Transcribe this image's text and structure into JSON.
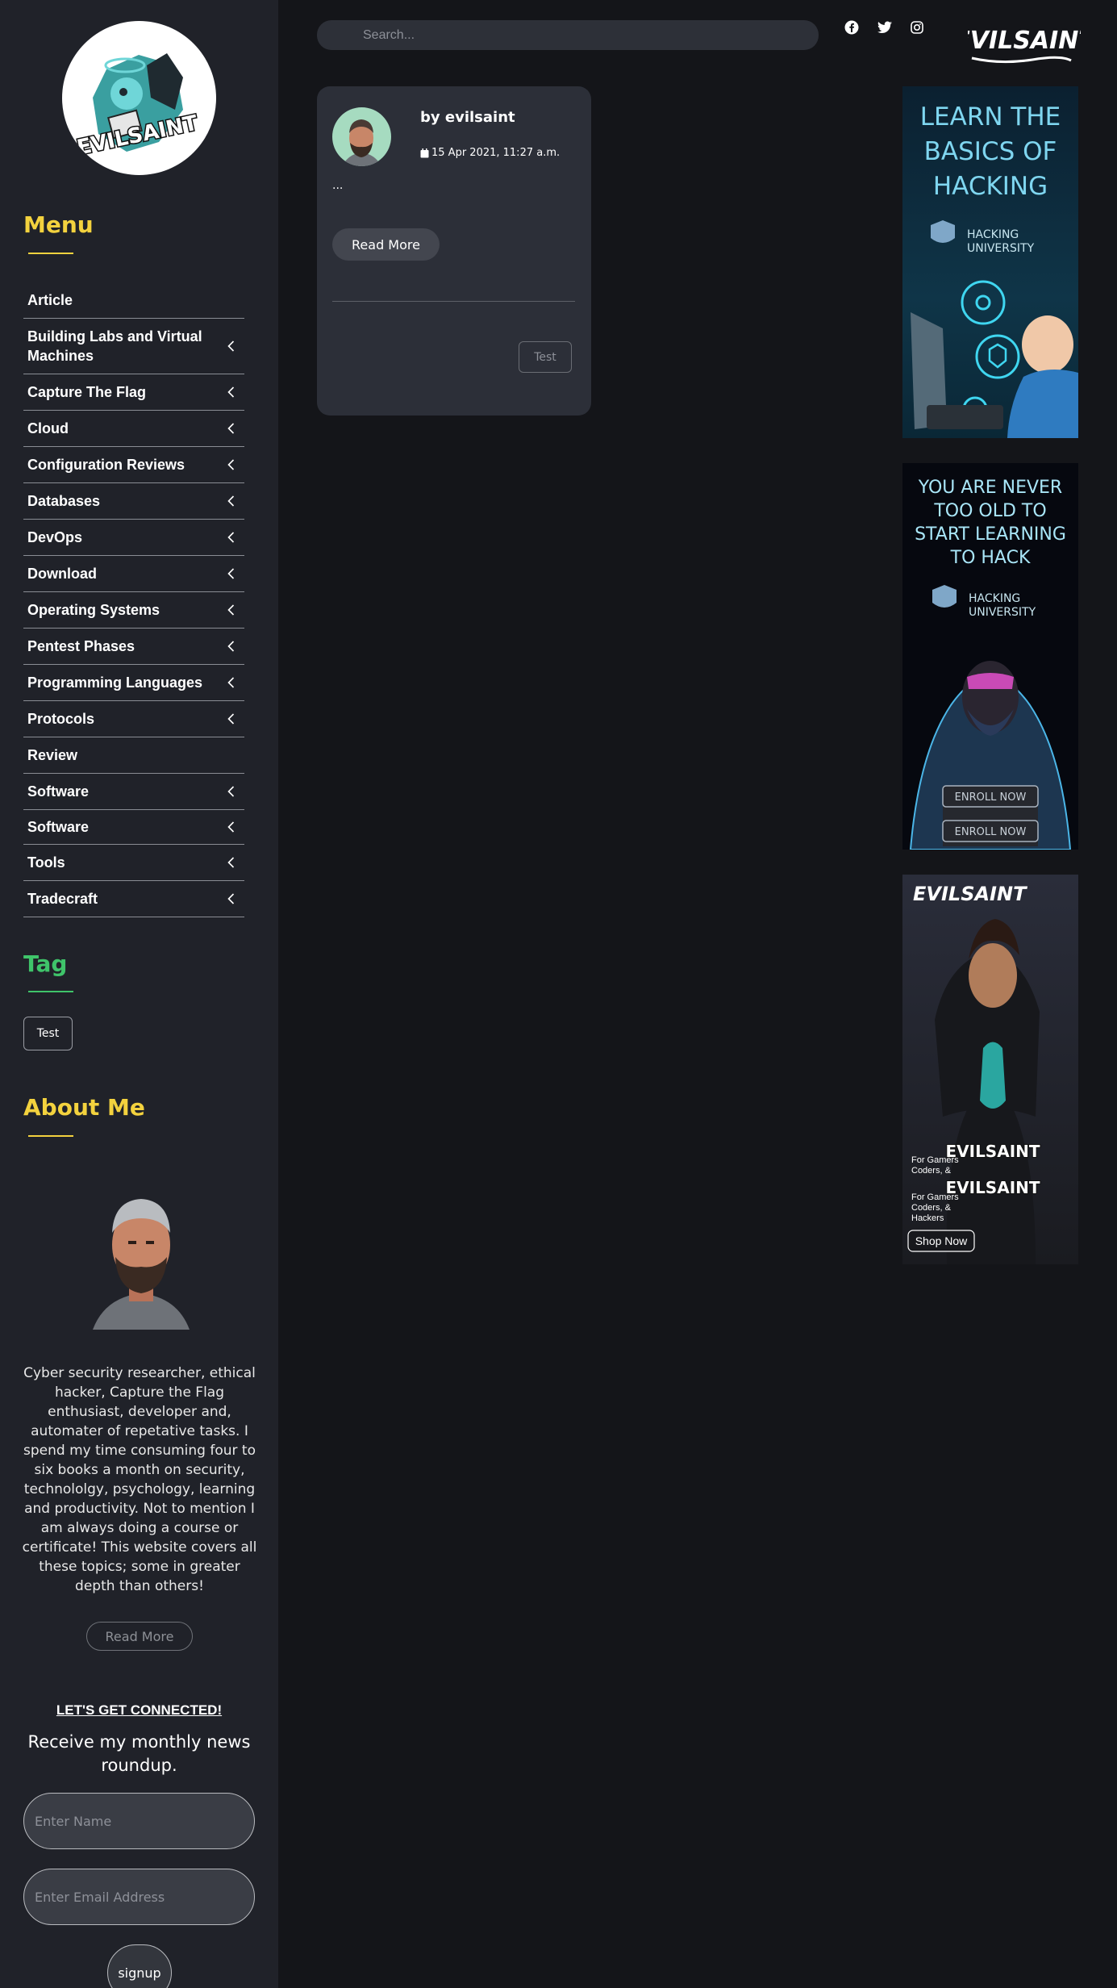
{
  "sidebar": {
    "logo_text": "EVILSAINT",
    "menu_title": "Menu",
    "menu_items": [
      {
        "label": "Article",
        "has_chevron": false
      },
      {
        "label": "Building Labs and Virtual Machines",
        "has_chevron": true
      },
      {
        "label": "Capture The Flag",
        "has_chevron": true
      },
      {
        "label": "Cloud",
        "has_chevron": true
      },
      {
        "label": "Configuration Reviews",
        "has_chevron": true
      },
      {
        "label": "Databases",
        "has_chevron": true
      },
      {
        "label": "DevOps",
        "has_chevron": true
      },
      {
        "label": "Download",
        "has_chevron": true
      },
      {
        "label": "Operating Systems",
        "has_chevron": true
      },
      {
        "label": "Pentest Phases",
        "has_chevron": true
      },
      {
        "label": "Programming Languages",
        "has_chevron": true
      },
      {
        "label": "Protocols",
        "has_chevron": true
      },
      {
        "label": "Review",
        "has_chevron": false
      },
      {
        "label": "Software",
        "has_chevron": true
      },
      {
        "label": "Software",
        "has_chevron": true
      },
      {
        "label": "Tools",
        "has_chevron": true
      },
      {
        "label": "Tradecraft",
        "has_chevron": true
      }
    ],
    "tag_title": "Tag",
    "tags": [
      "Test"
    ],
    "about_title": "About Me",
    "about_text": "Cyber security researcher, ethical hacker, Capture the Flag enthusiast, developer and, automater of repetative tasks. I spend my time consuming four to six books a month on security, technololgy, psychology, learning and productivity. Not to mention I am always doing a course or certificate! This website covers all these topics; some in greater depth than others!",
    "about_button": "Read More",
    "connect_heading": "LET'S GET CONNECTED!",
    "connect_sub": "Receive my monthly news roundup.",
    "name_placeholder": "Enter Name",
    "email_placeholder": "Enter Email Address",
    "signup_label": "signup"
  },
  "header": {
    "search_placeholder": "Search...",
    "social_icons": [
      "facebook-icon",
      "twitter-icon",
      "instagram-icon"
    ],
    "brand": "EVILSAINT"
  },
  "post": {
    "author": "by evilsaint",
    "date": "15 Apr 2021, 11:27 a.m.",
    "excerpt": "...",
    "read_more": "Read More",
    "tag": "Test"
  },
  "ads": [
    {
      "headline": "LEARN THE BASICS OF HACKING",
      "brand": "HACKING UNIVERSITY"
    },
    {
      "headline": "YOU ARE NEVER TOO OLD TO START LEARNING TO HACK",
      "brand": "HACKING UNIVERSITY",
      "cta1": "ENROLL NOW",
      "cta2": "ENROLL NOW"
    },
    {
      "brand": "EVILSAINT",
      "tagline1": "For Gamers Coders, & Hackers",
      "tagline2": "For Gamers Coders, & Hackers",
      "cta": "Shop Now",
      "shirt_text1": "EVILSAINT",
      "shirt_text2": "EVILSAINT"
    }
  ],
  "colors": {
    "accent_yellow": "#f3d23e",
    "accent_green": "#3fc46a",
    "sidebar_bg": "#202229",
    "page_bg": "#141519",
    "card_bg": "#2c2f38"
  }
}
